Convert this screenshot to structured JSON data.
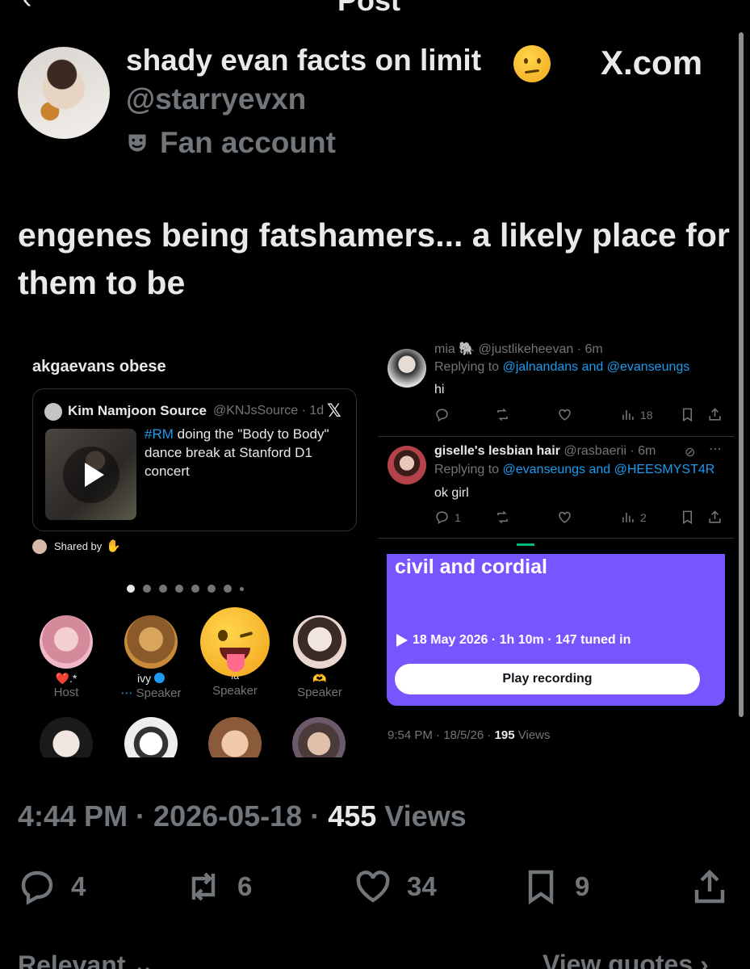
{
  "header": {
    "title": "Post",
    "back_icon": "back-arrow-icon"
  },
  "author": {
    "name": "shady evan facts on limit",
    "status_emoji": "confused-face-emoji",
    "handle": "@starryevxn",
    "label": "Fan account",
    "label_icon": "performing-arts-mask-icon",
    "watermark": "X.com"
  },
  "tweet": {
    "text": "engenes being fatshamers... a likely place for them to be"
  },
  "left_panel": {
    "title": "akgaevans obese",
    "card": {
      "source_name": "Kim Namjoon Source",
      "source_handle": "@KNJsSource · 1d",
      "x_logo": "𝕏",
      "hashtag": "#RM",
      "description": " doing the \"Body to Body\" dance break at Stanford D1 concert"
    },
    "shared_by": "Shared by",
    "speakers": [
      {
        "name": "❤️.*",
        "role": "Host"
      },
      {
        "name": "ivy",
        "role": "Speaker",
        "prefix": "⋯"
      },
      {
        "name": "ıa",
        "role": "Speaker"
      },
      {
        "name": "🫶",
        "role": "Speaker"
      }
    ]
  },
  "right_panel": {
    "reply1": {
      "partial_top": "mia 🐘 @justlikeheevan · 6m",
      "replying_to": "Replying to",
      "mentions": "@jalnandans and @evanseungs",
      "text": "hi",
      "views": "18"
    },
    "reply2": {
      "name": "giselle's lesbian hair",
      "handle": "@rasbaerii · 6m",
      "replying_to": "Replying to",
      "mentions": "@evanseungs and @HEESMYST4R",
      "text": "ok girl",
      "replies": "1",
      "views": "2"
    },
    "space": {
      "title": "civil and cordial",
      "meta": "18 May 2026 · 1h 10m · 147 tuned in",
      "button": "Play recording",
      "color": "#7856ff"
    },
    "stamp_time": "9:54 PM · 18/5/26 · ",
    "stamp_views": "195",
    "stamp_views_label": " Views"
  },
  "footer": {
    "timestamp": "4:44 PM · 2026-05-18 · ",
    "views": "455",
    "views_label": " Views",
    "replies": "4",
    "reposts": "6",
    "likes": "34",
    "bookmarks": "9",
    "tab_left": "Relevant ⌄",
    "tab_right": "View quotes ›"
  }
}
